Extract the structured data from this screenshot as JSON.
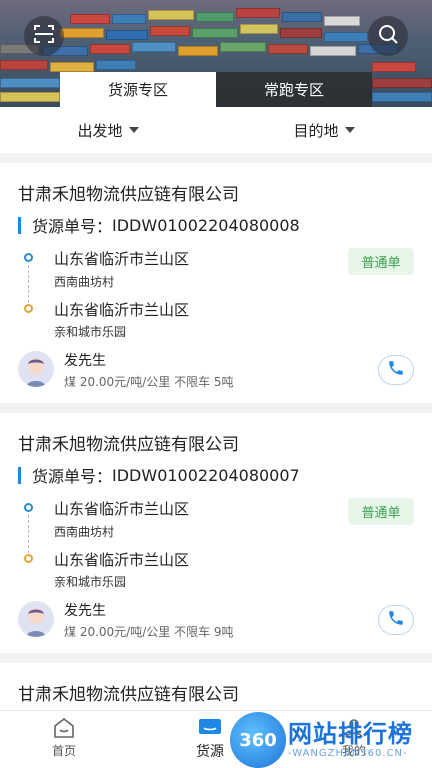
{
  "header": {
    "tabs": [
      {
        "label": "货源专区",
        "active": true
      },
      {
        "label": "常跑专区",
        "active": false
      }
    ]
  },
  "filters": {
    "origin_label": "出发地",
    "destination_label": "目的地"
  },
  "cards": [
    {
      "company": "甘肃禾旭物流供应链有限公司",
      "order_prefix": "货源单号：",
      "order_no": "IDDW01002204080008",
      "from_city": "山东省临沂市兰山区",
      "from_detail": "西南曲坊村",
      "to_city": "山东省临沂市兰山区",
      "to_detail": "亲和城市乐园",
      "tag": "普通单",
      "contact": "发先生",
      "info": "煤 20.00元/吨/公里 不限车 5吨"
    },
    {
      "company": "甘肃禾旭物流供应链有限公司",
      "order_prefix": "货源单号：",
      "order_no": "IDDW01002204080007",
      "from_city": "山东省临沂市兰山区",
      "from_detail": "西南曲坊村",
      "to_city": "山东省临沂市兰山区",
      "to_detail": "亲和城市乐园",
      "tag": "普通单",
      "contact": "发先生",
      "info": "煤 20.00元/吨/公里 不限车 9吨"
    },
    {
      "company": "甘肃禾旭物流供应链有限公司"
    }
  ],
  "nav": {
    "home": "首页",
    "goods": "货源",
    "mine": "我的"
  },
  "watermark": {
    "logo": "360",
    "title": "网站排行榜",
    "url": "-WANGZHAN360.CN-"
  },
  "colors": {
    "accent": "#1e88e5",
    "tag_bg": "#e8f6ea",
    "tag_text": "#3aa050",
    "origin_dot": "#2e8bc9",
    "dest_dot": "#e5a43a"
  }
}
